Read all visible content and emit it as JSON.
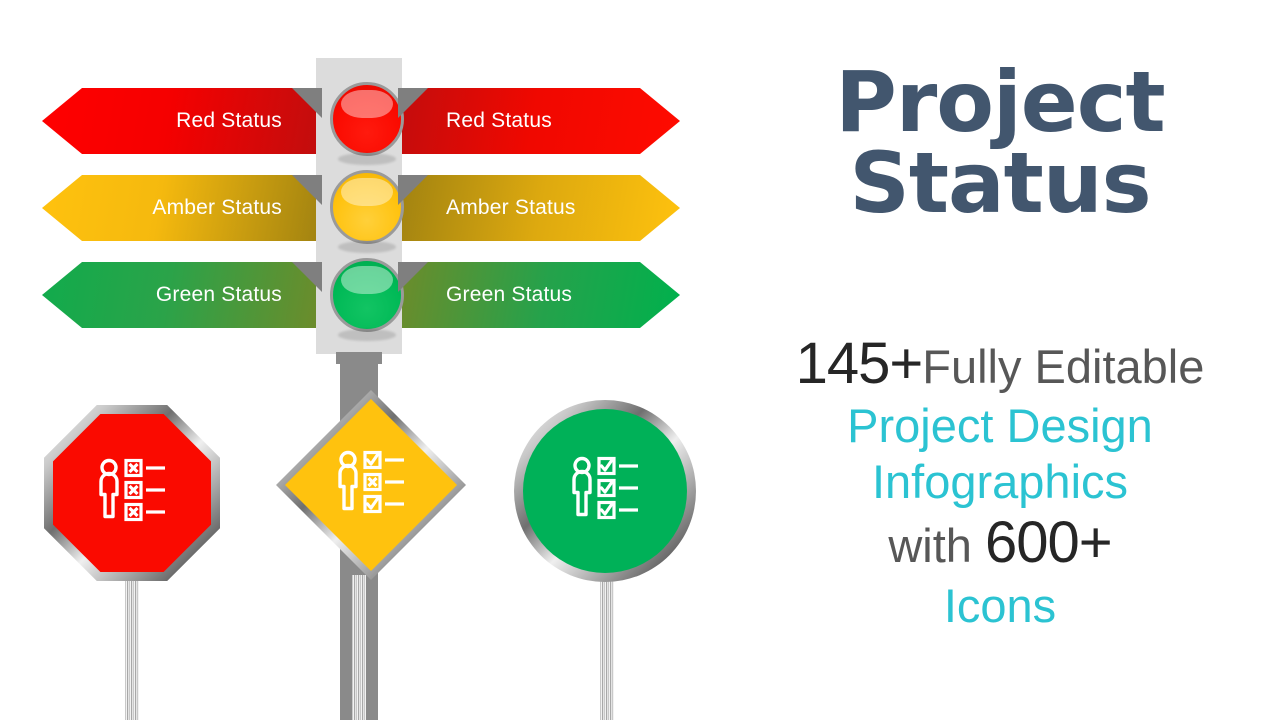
{
  "slide": {
    "background": "#FFFFFF",
    "title": {
      "line1": "Project",
      "line2": "Status",
      "color": "#42566E"
    },
    "subtitle": {
      "count_designs": "145+",
      "editable_text": "Fully Editable",
      "highlight_line1": "Project Design",
      "highlight_line2": "Infographics",
      "with_text": "with",
      "count_icons": "600+",
      "icons_text": "Icons",
      "accent_color": "#2BC3D2",
      "gray_color": "#575757",
      "dark_color": "#262626"
    }
  },
  "traffic_light": {
    "housing_color": "#DCDCDC",
    "lights": [
      {
        "name": "red-light",
        "color": "#FA0A00",
        "status": "Red"
      },
      {
        "name": "amber-light",
        "color": "#FFC20E",
        "status": "Amber"
      },
      {
        "name": "green-light",
        "color": "#00B956",
        "status": "Green"
      }
    ]
  },
  "banners": {
    "left": [
      {
        "label": "Red Status",
        "color_start": "#FF0000",
        "color_end": "#B80C0C"
      },
      {
        "label": "Amber Status",
        "color_start": "#FFC20E",
        "color_end": "#A08211"
      },
      {
        "label": "Green Status",
        "color_start": "#15A94B",
        "color_end": "#6E8B2A"
      }
    ],
    "right": [
      {
        "label": "Red Status",
        "color_start": "#C20D0D",
        "color_end": "#FF0B00"
      },
      {
        "label": "Amber Status",
        "color_start": "#A08211",
        "color_end": "#FFC20E"
      },
      {
        "label": "Green Status",
        "color_start": "#6E8B2A",
        "color_end": "#00B14D"
      }
    ],
    "fold_color": "#7F7F7F"
  },
  "signs": [
    {
      "name": "stop-sign-red",
      "shape": "octagon",
      "color": "#FA0A00",
      "icon": "person-checklist-icon",
      "checkboxes": [
        "x",
        "x",
        "x"
      ]
    },
    {
      "name": "diamond-sign-amber",
      "shape": "diamond",
      "color": "#FFC20E",
      "icon": "person-checklist-icon",
      "checkboxes": [
        "check",
        "x",
        "check"
      ]
    },
    {
      "name": "circle-sign-green",
      "shape": "circle",
      "color": "#00B158",
      "icon": "person-checklist-icon",
      "checkboxes": [
        "check",
        "check",
        "check"
      ]
    }
  ]
}
